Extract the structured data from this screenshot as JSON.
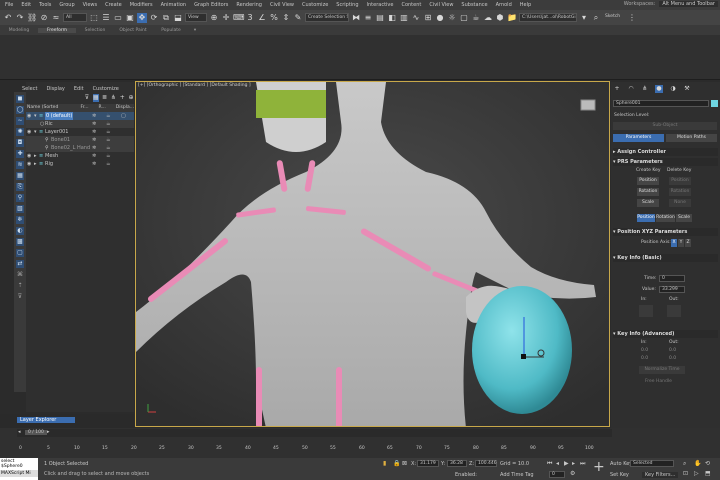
{
  "menubar": {
    "items": [
      "File",
      "Edit",
      "Tools",
      "Group",
      "Views",
      "Create",
      "Modifiers",
      "Animation",
      "Graph Editors",
      "Rendering",
      "Civil View",
      "Customize",
      "Scripting",
      "Interactive",
      "Content",
      "Civil View",
      "Substance",
      "Arnold",
      "Help"
    ],
    "workspaces_label": "Workspaces:",
    "workspace_value": "Alt Menu and Toolbar"
  },
  "toolbar": {
    "filter_value": "All",
    "view_value": "View",
    "selection_set_placeholder": "Create Selection Se",
    "path_value": "C:\\Users\\jat...ol\\RobotGir",
    "sketch_label": "Sketch"
  },
  "ribbon": {
    "tabs": [
      "Modeling",
      "Freeform",
      "Selection",
      "Object Paint",
      "Populate"
    ],
    "active": "Freeform"
  },
  "scene_explorer": {
    "menu": [
      "Select",
      "Display",
      "Edit",
      "Customize"
    ],
    "columns": [
      "Name (Sorted Ascending)",
      "Fr...",
      "R...",
      "Displa..."
    ],
    "rows": [
      {
        "name": "0 (default)",
        "indent": 1,
        "selected": true
      },
      {
        "name": "Ric",
        "indent": 2
      },
      {
        "name": "Layer001",
        "indent": 1
      },
      {
        "name": "Bone01",
        "indent": 3
      },
      {
        "name": "Bone02_L Hand",
        "indent": 3
      },
      {
        "name": "Mesh",
        "indent": 1
      },
      {
        "name": "Rig",
        "indent": 1
      }
    ]
  },
  "layer_explorer": {
    "label": "Layer Explorer",
    "frame_counter": "0 / 100"
  },
  "viewport": {
    "label": "[+] [Orthographic ] [Standard ] [Default Shading ]",
    "border_color": "#c8a84a",
    "sphere_color": "#5ec8d2",
    "bone_color": "#e98bb6",
    "helmet_color": "#8fb33a"
  },
  "command_panel": {
    "object_name": "Sphere001",
    "selection_level_label": "Selection Level:",
    "sub_object_label": "Sub-Object",
    "parameters_label": "Parameters",
    "motion_paths_label": "Motion Paths",
    "assign_controller": "Assign Controller",
    "prs_parameters": "PRS Parameters",
    "create_key_label": "Create Key",
    "delete_key_label": "Delete Key",
    "position_btn": "Position",
    "rotation_btn": "Rotation",
    "scale_btn": "Scale",
    "none_label": "None",
    "pos_tab": "Position",
    "rot_tab": "Rotation",
    "scale_tab": "Scale",
    "position_xyz": "Position XYZ Parameters",
    "position_axis_label": "Position Axis:",
    "axes": [
      "X",
      "Y",
      "Z"
    ],
    "key_info_basic": "Key Info (Basic)",
    "time_label": "Time:",
    "time_value": "0",
    "value_label": "Value:",
    "value_value": "33.299",
    "in_label": "In:",
    "out_label": "Out:",
    "key_info_advanced": "Key Info (Advanced)",
    "in_out_values": [
      "0.0",
      "0.0",
      "0.0",
      "0.0"
    ],
    "normalize_time": "Normalize Time",
    "free_handle": "Free Handle"
  },
  "timeline": {
    "ticks": [
      "0",
      "5",
      "10",
      "15",
      "20",
      "25",
      "30",
      "35",
      "40",
      "45",
      "50",
      "55",
      "60",
      "65",
      "70",
      "75",
      "80",
      "85",
      "90",
      "95",
      "100"
    ]
  },
  "status": {
    "maxscript_label": "select $Sphere0",
    "maxscript_sub": "MAXScript Mi",
    "objects_selected": "1 Object Selected",
    "hint": "Click and drag to select and move objects",
    "x_label": "X:",
    "x_value": "31.179",
    "y_label": "Y:",
    "y_value": "36.28",
    "z_label": "Z:",
    "z_value": "100.446",
    "grid_label": "Grid = 10.0",
    "enabled_label": "Enabled:",
    "add_time_tag": "Add Time Tag",
    "auto_key": "Auto Key",
    "selected_value": "Selected",
    "set_key": "Set Key",
    "key_filters": "Key Filters...",
    "frame_value": "0"
  }
}
